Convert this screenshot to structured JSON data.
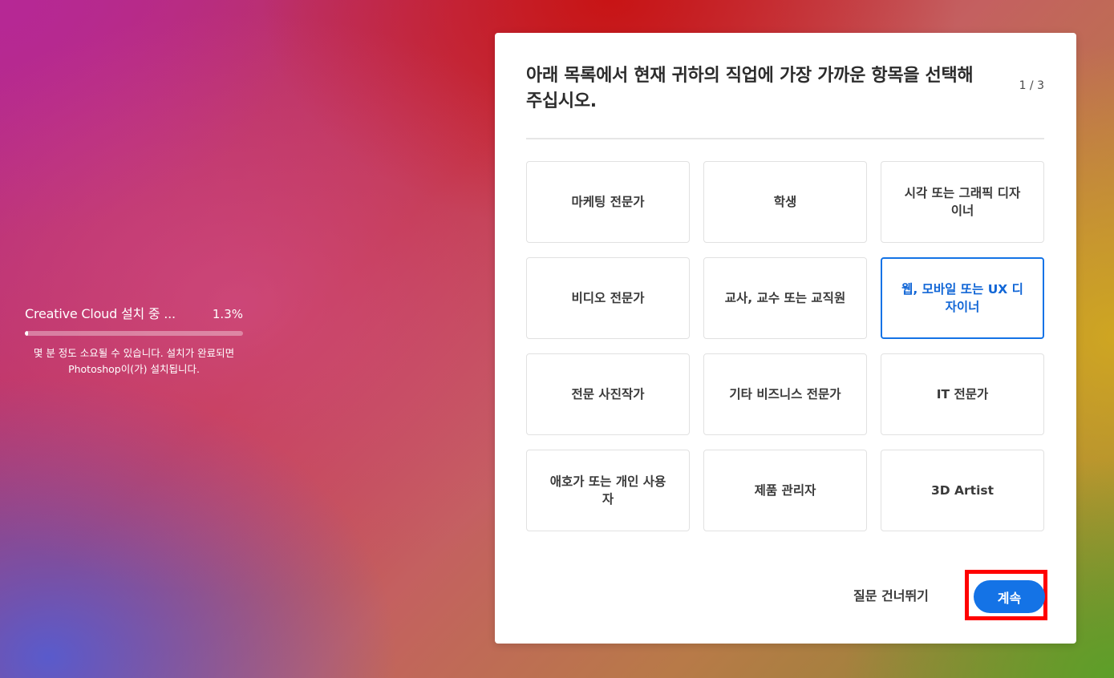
{
  "install": {
    "title": "Creative Cloud 설치 중 ...",
    "percent_label": "1.3%",
    "progress": 0.013,
    "note": "몇 분 정도 소요될 수 있습니다. 설치가 완료되면 Photoshop이(가) 설치됩니다."
  },
  "dialog": {
    "title": "아래 목록에서 현재 귀하의 직업에 가장 가까운 항목을 선택해 주십시오.",
    "step": "1 / 3",
    "options": [
      {
        "label": "마케팅 전문가"
      },
      {
        "label": "학생"
      },
      {
        "label": "시각 또는 그래픽 디자이너"
      },
      {
        "label": "비디오 전문가"
      },
      {
        "label": "교사, 교수 또는 교직원"
      },
      {
        "label": "웹, 모바일 또는 UX 디자이너",
        "selected": true
      },
      {
        "label": "전문 사진작가"
      },
      {
        "label": "기타 비즈니스 전문가"
      },
      {
        "label": "IT 전문가"
      },
      {
        "label": "애호가 또는 개인 사용자"
      },
      {
        "label": "제품 관리자"
      },
      {
        "label": "3D Artist"
      }
    ],
    "skip_label": "질문 건너뛰기",
    "continue_label": "계속"
  },
  "colors": {
    "accent": "#1473e6",
    "highlight": "#ff0000"
  }
}
